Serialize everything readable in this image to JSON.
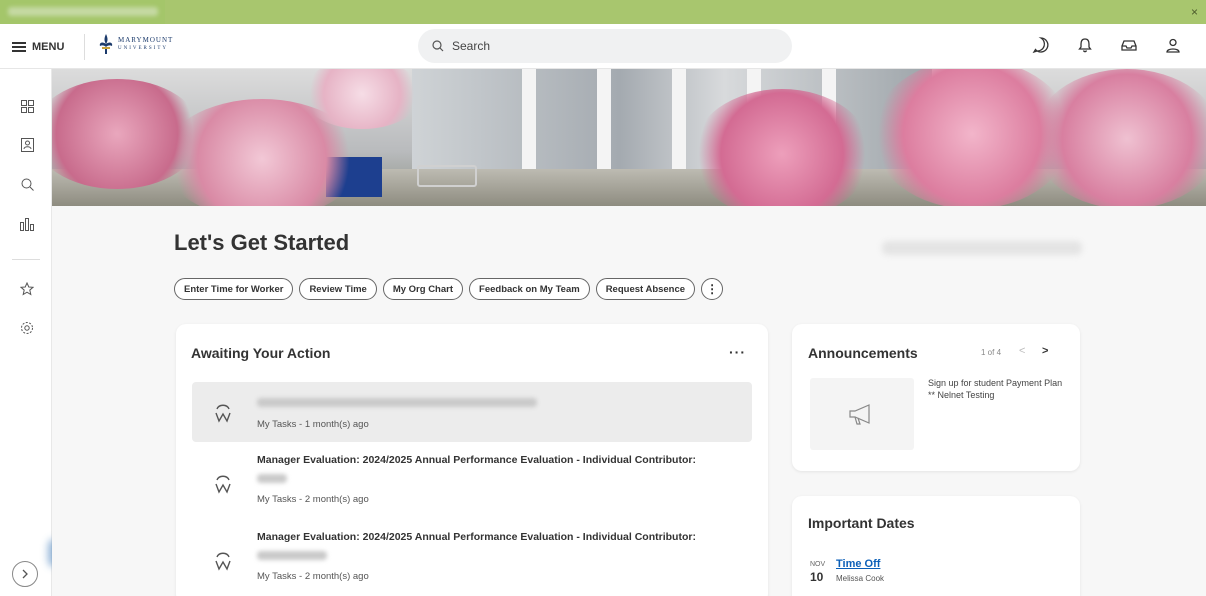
{
  "window": {
    "close_glyph": "×"
  },
  "header": {
    "menu_label": "MENU",
    "logo_line1": "MARYMOUNT",
    "logo_line2": "UNIVERSITY",
    "search_placeholder": "Search",
    "icons": [
      "chat-icon",
      "notification-bell-icon",
      "inbox-icon",
      "profile-icon"
    ]
  },
  "sidebar": {
    "icons": [
      "apps-icon",
      "my-profile-icon",
      "search-icon",
      "reports-icon",
      "favorites-star-icon",
      "settings-icon"
    ]
  },
  "main": {
    "title": "Let's Get Started",
    "quick_actions": [
      "Enter Time for Worker",
      "Review Time",
      "My Org Chart",
      "Feedback on My Team",
      "Request Absence"
    ],
    "more_label": "⋮"
  },
  "awaiting": {
    "title": "Awaiting Your Action",
    "menu_label": "···",
    "tasks": [
      {
        "title": "",
        "meta": "My Tasks - 1 month(s) ago"
      },
      {
        "title": "Manager Evaluation: 2024/2025 Annual Performance Evaluation - Individual Contributor:",
        "meta": "My Tasks - 2 month(s) ago"
      },
      {
        "title": "Manager Evaluation: 2024/2025 Annual Performance Evaluation - Individual Contributor:",
        "meta": "My Tasks - 2 month(s) ago"
      }
    ]
  },
  "announcements": {
    "title": "Announcements",
    "pager": "1 of 4",
    "prev": "<",
    "next": ">",
    "text": "Sign up for student Payment Plan ** Nelnet Testing"
  },
  "important_dates": {
    "title": "Important Dates",
    "items": [
      {
        "month": "NOV",
        "day": "10",
        "label": "Time Off",
        "person": "Melissa Cook"
      }
    ]
  },
  "colors": {
    "top_strip": "#a4c66a",
    "link": "#0b5fb8",
    "brand_navy": "#1b3a6b"
  }
}
